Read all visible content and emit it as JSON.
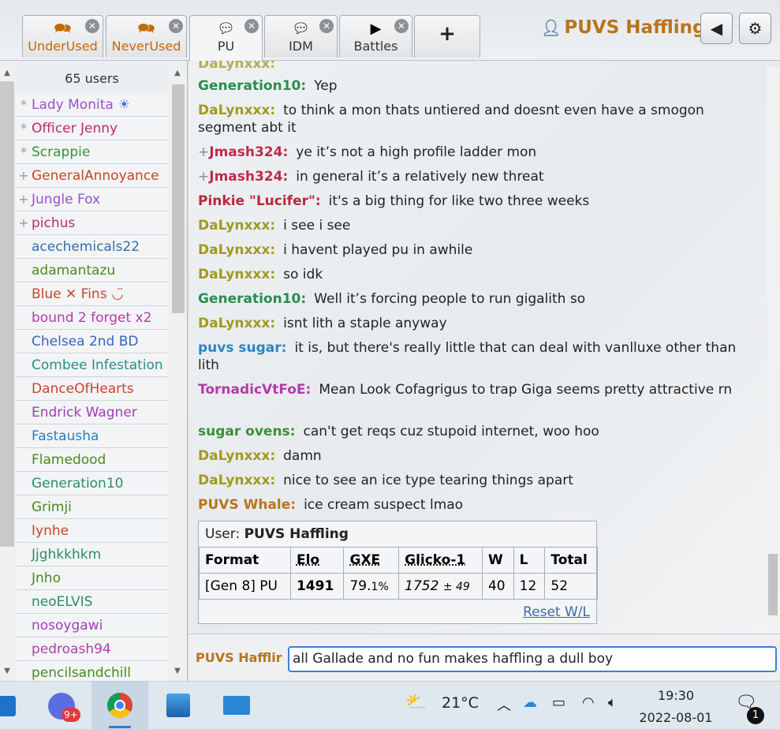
{
  "header": {
    "tabs": [
      {
        "label": "UnderUsed",
        "icon": "chat-bubbles-icon",
        "style": "orange"
      },
      {
        "label": "NeverUsed",
        "icon": "chat-bubbles-icon",
        "style": "orange"
      },
      {
        "label": "PU",
        "icon": "chat-bubble-icon",
        "style": "active"
      },
      {
        "label": "IDM",
        "icon": "chat-bubble-icon",
        "style": "normal"
      },
      {
        "label": "Battles",
        "icon": "battles-icon",
        "style": "normal"
      }
    ],
    "new_tab_label": "+",
    "username": "PUVS Haffling"
  },
  "userlist": {
    "count": "65 users",
    "users": [
      {
        "rank": "*",
        "name": "Lady Monita",
        "suffix": "☀",
        "color": "#9b52c7"
      },
      {
        "rank": "*",
        "name": "Officer Jenny",
        "suffix": "",
        "color": "#c02a6a"
      },
      {
        "rank": "*",
        "name": "Scrappie",
        "suffix": "",
        "color": "#3a8f3a"
      },
      {
        "rank": "+",
        "name": "GeneralAnnoyance",
        "suffix": "",
        "color": "#c8452a"
      },
      {
        "rank": "+",
        "name": "Jungle Fox",
        "suffix": "",
        "color": "#9b52c7"
      },
      {
        "rank": "+",
        "name": "pichus",
        "suffix": "",
        "color": "#c02a6a"
      },
      {
        "rank": "",
        "name": "acechemicals22",
        "suffix": "",
        "color": "#3570a8"
      },
      {
        "rank": "",
        "name": "adamantazu",
        "suffix": "",
        "color": "#4b8a1e"
      },
      {
        "rank": "",
        "name": "Blue ✕ Fins",
        "suffix": "◡̈",
        "color": "#c8452a"
      },
      {
        "rank": "",
        "name": "bound 2 forget x2",
        "suffix": "",
        "color": "#b43ba8"
      },
      {
        "rank": "",
        "name": "Chelsea 2nd BD",
        "suffix": "",
        "color": "#3a62c2"
      },
      {
        "rank": "",
        "name": "Combee Infestation",
        "suffix": "",
        "color": "#2a8d86"
      },
      {
        "rank": "",
        "name": "DanceOfHearts",
        "suffix": "",
        "color": "#c8452a"
      },
      {
        "rank": "",
        "name": "Endrick Wagner",
        "suffix": "",
        "color": "#a23db7"
      },
      {
        "rank": "",
        "name": "Fastausha",
        "suffix": "",
        "color": "#2a7fb8"
      },
      {
        "rank": "",
        "name": "Flamedood",
        "suffix": "",
        "color": "#4b8a1e"
      },
      {
        "rank": "",
        "name": "Generation10",
        "suffix": "",
        "color": "#2a8d66"
      },
      {
        "rank": "",
        "name": "Grimji",
        "suffix": "",
        "color": "#4b8a1e"
      },
      {
        "rank": "",
        "name": "Iynhe",
        "suffix": "",
        "color": "#c8452a"
      },
      {
        "rank": "",
        "name": "Jjghkkhkm",
        "suffix": "",
        "color": "#2a8d66"
      },
      {
        "rank": "",
        "name": "Jnho",
        "suffix": "",
        "color": "#4b8a1e"
      },
      {
        "rank": "",
        "name": "neoELVIS",
        "suffix": "",
        "color": "#2a8d66"
      },
      {
        "rank": "",
        "name": "nosoygawi",
        "suffix": "",
        "color": "#a23db7"
      },
      {
        "rank": "",
        "name": "pedroash94",
        "suffix": "",
        "color": "#b43ba8"
      },
      {
        "rank": "",
        "name": "pencilsandchill",
        "suffix": "",
        "color": "#4b8a1e"
      }
    ]
  },
  "chat": {
    "messages": [
      {
        "user": "Generation10:",
        "color": "#2a8d4e",
        "plus": "",
        "text": "Yep"
      },
      {
        "user": "DaLynxxx:",
        "color": "#a19a1c",
        "plus": "",
        "text": "to think a mon thats untiered and doesnt even have a smogon segment abt it"
      },
      {
        "user": "Jmash324:",
        "color": "#c02a4a",
        "plus": "+",
        "text": "ye it’s not a high profile ladder mon"
      },
      {
        "user": "Jmash324:",
        "color": "#c02a4a",
        "plus": "+",
        "text": "in general it’s a relatively new threat"
      },
      {
        "user": "Pinkie \"Lucifer\":",
        "color": "#b52a3c",
        "plus": "",
        "text": "it's a big thing for like two three weeks"
      },
      {
        "user": "DaLynxxx:",
        "color": "#a19a1c",
        "plus": "",
        "text": "i see i see"
      },
      {
        "user": "DaLynxxx:",
        "color": "#a19a1c",
        "plus": "",
        "text": "i havent played pu in awhile"
      },
      {
        "user": "DaLynxxx:",
        "color": "#a19a1c",
        "plus": "",
        "text": "so idk"
      },
      {
        "user": "Generation10:",
        "color": "#2a8d4e",
        "plus": "",
        "text": "Well it’s forcing people to run gigalith so"
      },
      {
        "user": "DaLynxxx:",
        "color": "#a19a1c",
        "plus": "",
        "text": "isnt lith a staple anyway"
      },
      {
        "user": "puvs sugar:",
        "color": "#2a86c2",
        "plus": "",
        "text": "it is, but there's really little that can deal with vanlluxe other than lith"
      },
      {
        "user": "TornadicVtFoE:",
        "color": "#b43ba8",
        "plus": "",
        "text": "Mean Look Cofagrigus to trap Giga seems pretty attractive rn"
      },
      {
        "user": "sugar ovens:",
        "color": "#3a8f3a",
        "plus": "",
        "text": "can't get reqs cuz stupoid internet, woo hoo"
      },
      {
        "user": "DaLynxxx:",
        "color": "#a19a1c",
        "plus": "",
        "text": "damn"
      },
      {
        "user": "DaLynxxx:",
        "color": "#a19a1c",
        "plus": "",
        "text": "nice to see an ice type tearing things apart"
      },
      {
        "user": "PUVS Whale:",
        "color": "#b9741c",
        "plus": "",
        "text": "ice cream suspect lmao"
      }
    ],
    "stats": {
      "user_label": "User:",
      "user": "PUVS Haffling",
      "headers": [
        "Format",
        "Elo",
        "GXE",
        "Glicko-1",
        "W",
        "L",
        "Total"
      ],
      "row": {
        "format": "[Gen 8] PU",
        "elo": "1491",
        "gxe": "79.",
        "gxe_decimal": "1%",
        "glicko": "1752",
        "glicko_dev": "± 49",
        "w": "40",
        "l": "12",
        "total": "52"
      },
      "reset": "Reset W/L"
    }
  },
  "composer": {
    "name": "PUVS Hafflir",
    "value": "all Gallade and no fun makes haffling a dull boy"
  },
  "taskbar": {
    "weather": "21°C",
    "time": "19:30",
    "date": "2022-08-01",
    "discord_badge": "9+",
    "notifications": "1"
  }
}
